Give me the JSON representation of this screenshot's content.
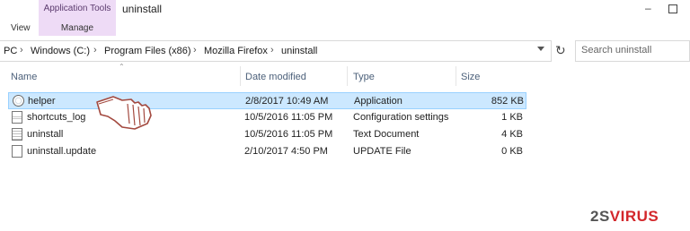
{
  "ribbon": {
    "context_group": "Application Tools",
    "tabs": [
      "View",
      "Manage"
    ],
    "title": "uninstall"
  },
  "address": {
    "crumbs": [
      "PC",
      "Windows (C:)",
      "Program Files (x86)",
      "Mozilla Firefox",
      "uninstall"
    ],
    "search_placeholder": "Search uninstall"
  },
  "columns": [
    "Name",
    "Date modified",
    "Type",
    "Size"
  ],
  "files": [
    {
      "name": "helper",
      "date": "2/8/2017 10:49 AM",
      "type": "Application",
      "size": "852 KB",
      "icon": "application-icon",
      "selected": true
    },
    {
      "name": "shortcuts_log",
      "date": "10/5/2016 11:05 PM",
      "type": "Configuration settings",
      "size": "1 KB",
      "icon": "config-file-icon",
      "selected": false
    },
    {
      "name": "uninstall",
      "date": "10/5/2016 11:05 PM",
      "type": "Text Document",
      "size": "4 KB",
      "icon": "text-file-icon",
      "selected": false
    },
    {
      "name": "uninstall.update",
      "date": "2/10/2017 4:50 PM",
      "type": "UPDATE File",
      "size": "0 KB",
      "icon": "blank-file-icon",
      "selected": false
    }
  ],
  "watermark": {
    "part1": "2S",
    "part2": "VIRUS"
  },
  "colors": {
    "selection": "#cce8ff",
    "context_tab": "#eedbf6",
    "watermark_red": "#d3272b"
  }
}
